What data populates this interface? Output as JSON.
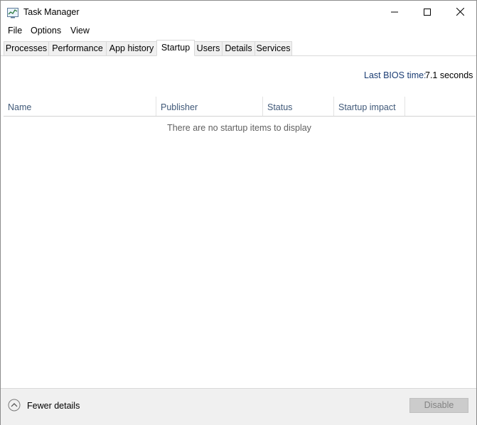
{
  "window": {
    "title": "Task Manager"
  },
  "menu": {
    "items": [
      "File",
      "Options",
      "View"
    ]
  },
  "tabs": [
    {
      "label": "Processes",
      "active": false
    },
    {
      "label": "Performance",
      "active": false
    },
    {
      "label": "App history",
      "active": false
    },
    {
      "label": "Startup",
      "active": true
    },
    {
      "label": "Users",
      "active": false
    },
    {
      "label": "Details",
      "active": false
    },
    {
      "label": "Services",
      "active": false
    }
  ],
  "bios": {
    "label": "Last BIOS time:",
    "value": "7.1 seconds"
  },
  "table": {
    "columns": [
      "Name",
      "Publisher",
      "Status",
      "Startup impact"
    ],
    "empty_message": "There are no startup items to display"
  },
  "footer": {
    "fewer_details_label": "Fewer details",
    "disable_label": "Disable",
    "disable_enabled": false
  },
  "colors": {
    "header_text": "#3f5878",
    "bios_label": "#1a3c73",
    "footer_bg": "#f0f0f0",
    "tab_bg": "#f0f0f0"
  },
  "icons": {
    "app": "task-manager-icon",
    "minimize": "minimize-icon",
    "maximize": "maximize-icon",
    "close": "close-icon",
    "fewer": "chevron-up-circle-icon"
  }
}
